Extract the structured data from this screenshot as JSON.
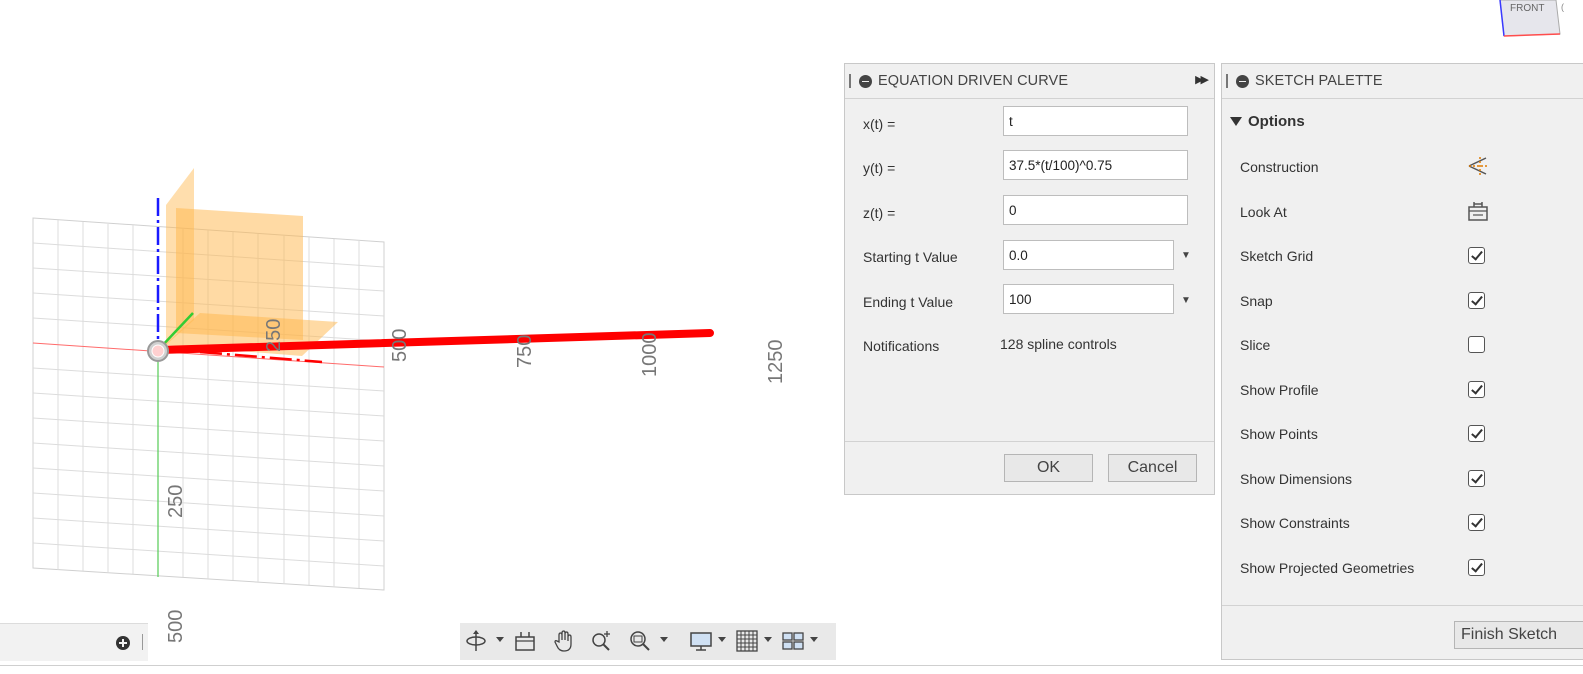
{
  "viewport": {
    "axis_labels_x": [
      "250",
      "500",
      "750",
      "1000",
      "1250"
    ],
    "axis_labels_y": [
      "250",
      "500"
    ],
    "viewcube_face": "FRONT"
  },
  "equation_panel": {
    "title": "EQUATION DRIVEN CURVE",
    "fields": [
      {
        "label": "x(t) =",
        "value": "t"
      },
      {
        "label": "y(t) =",
        "value": "37.5*(t/100)^0.75"
      },
      {
        "label": "z(t) =",
        "value": "0"
      },
      {
        "label": "Starting t Value",
        "value": "0.0"
      },
      {
        "label": "Ending t Value",
        "value": "100"
      }
    ],
    "notifications_label": "Notifications",
    "notifications_value": "128 spline controls",
    "ok_label": "OK",
    "cancel_label": "Cancel"
  },
  "sketch_palette": {
    "title": "SKETCH PALETTE",
    "section": "Options",
    "options": [
      {
        "label": "Construction",
        "control": "construction-icon"
      },
      {
        "label": "Look At",
        "control": "look-at-icon"
      },
      {
        "label": "Sketch Grid",
        "checked": true
      },
      {
        "label": "Snap",
        "checked": true
      },
      {
        "label": "Slice",
        "checked": false
      },
      {
        "label": "Show Profile",
        "checked": true
      },
      {
        "label": "Show Points",
        "checked": true
      },
      {
        "label": "Show Dimensions",
        "checked": true
      },
      {
        "label": "Show Constraints",
        "checked": true
      },
      {
        "label": "Show Projected Geometries",
        "checked": true
      }
    ],
    "finish_label": "Finish Sketch"
  },
  "colors": {
    "curve": "#ff0000",
    "plane": "#ffb64a",
    "z_axis": "#1a1aff",
    "y_axis": "#33cc33",
    "grid": "#d9d9d9"
  }
}
